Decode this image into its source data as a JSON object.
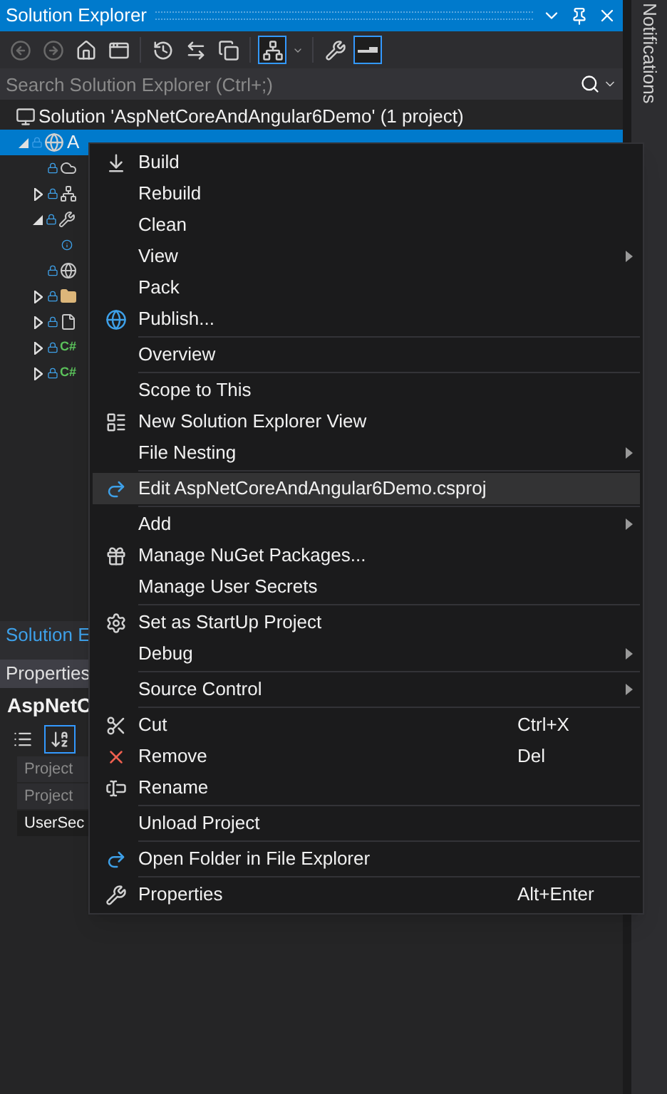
{
  "window": {
    "title": "Solution Explorer"
  },
  "toolbar": {
    "buttons": [
      {
        "selected": false
      },
      {
        "selected": false
      },
      {
        "selected": false
      },
      {
        "selected": false
      },
      {
        "selected": false
      },
      {
        "selected": false
      },
      {
        "selected": false
      },
      {
        "selected": true
      },
      {
        "selected": false
      },
      {
        "selected": false
      },
      {
        "selected": true
      }
    ]
  },
  "search": {
    "placeholder": "Search Solution Explorer (Ctrl+;)"
  },
  "tree": [
    {
      "label": "Solution 'AspNetCoreAndAngular6Demo' (1 project)",
      "expandable": false,
      "expanded": true,
      "selected": false,
      "children": [
        {
          "label": "A",
          "expandable": true,
          "expanded": true,
          "selected": true,
          "children": [
            {
              "expandable": false,
              "selected": false
            },
            {
              "expandable": true,
              "expanded": false,
              "selected": false
            },
            {
              "expandable": true,
              "expanded": true,
              "selected": false,
              "children": [
                {
                  "expandable": false,
                  "selected": false
                }
              ]
            },
            {
              "expandable": false,
              "selected": false
            },
            {
              "expandable": true,
              "expanded": false,
              "selected": false
            },
            {
              "expandable": true,
              "expanded": false,
              "selected": false
            },
            {
              "badge": "C#",
              "expandable": true,
              "expanded": false,
              "selected": false
            },
            {
              "badge": "C#",
              "expandable": true,
              "expanded": false,
              "selected": false
            }
          ]
        }
      ]
    }
  ],
  "bottom_tab": {
    "label": "Solution E"
  },
  "properties": {
    "title": "Properties",
    "object": "AspNetC",
    "sort_buttons": [
      {
        "selected": false
      },
      {
        "selected": true
      }
    ],
    "rows": [
      {
        "name": "Project",
        "disabled": true
      },
      {
        "name": "Project",
        "disabled": true
      },
      {
        "name": "UserSec",
        "disabled": false
      }
    ]
  },
  "context_menu": {
    "groups": [
      {
        "items": [
          {
            "label": "Build",
            "submenu": false,
            "selected": false
          },
          {
            "label": "Rebuild",
            "submenu": false,
            "selected": false
          },
          {
            "label": "Clean",
            "submenu": false,
            "selected": false
          },
          {
            "label": "View",
            "submenu": true,
            "selected": false
          },
          {
            "label": "Pack",
            "submenu": false,
            "selected": false
          },
          {
            "label": "Publish...",
            "submenu": false,
            "selected": false
          }
        ]
      },
      {
        "items": [
          {
            "label": "Overview",
            "submenu": false,
            "selected": false
          }
        ]
      },
      {
        "items": [
          {
            "label": "Scope to This",
            "submenu": false,
            "selected": false
          },
          {
            "label": "New Solution Explorer View",
            "submenu": false,
            "selected": false
          },
          {
            "label": "File Nesting",
            "submenu": true,
            "selected": false
          }
        ]
      },
      {
        "items": [
          {
            "label": "Edit AspNetCoreAndAngular6Demo.csproj",
            "submenu": false,
            "selected": true
          }
        ]
      },
      {
        "items": [
          {
            "label": "Add",
            "submenu": true,
            "selected": false
          },
          {
            "label": "Manage NuGet Packages...",
            "submenu": false,
            "selected": false
          },
          {
            "label": "Manage User Secrets",
            "submenu": false,
            "selected": false
          }
        ]
      },
      {
        "items": [
          {
            "label": "Set as StartUp Project",
            "submenu": false,
            "selected": false
          },
          {
            "label": "Debug",
            "submenu": true,
            "selected": false
          }
        ]
      },
      {
        "items": [
          {
            "label": "Source Control",
            "submenu": true,
            "selected": false
          }
        ]
      },
      {
        "items": [
          {
            "label": "Cut",
            "shortcut": "Ctrl+X",
            "submenu": false,
            "selected": false
          },
          {
            "label": "Remove",
            "shortcut": "Del",
            "submenu": false,
            "selected": false
          },
          {
            "label": "Rename",
            "submenu": false,
            "selected": false
          }
        ]
      },
      {
        "items": [
          {
            "label": "Unload Project",
            "submenu": false,
            "selected": false
          }
        ]
      },
      {
        "items": [
          {
            "label": "Open Folder in File Explorer",
            "submenu": false,
            "selected": false
          }
        ]
      },
      {
        "items": [
          {
            "label": "Properties",
            "shortcut": "Alt+Enter",
            "submenu": false,
            "selected": false
          }
        ]
      }
    ]
  },
  "side_panel": {
    "label": "Notifications"
  }
}
